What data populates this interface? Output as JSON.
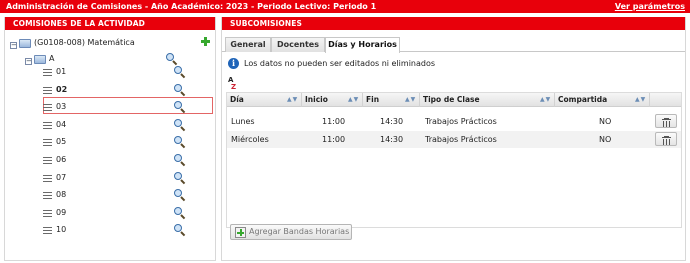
{
  "topbar": {
    "title": "Administración de Comisiones - Año Académico: 2023 - Periodo Lectivo: Periodo 1",
    "params_link": "Ver parámetros"
  },
  "left_panel": {
    "title": "COMISIONES DE LA ACTIVIDAD",
    "root": {
      "label": "(G0108-008) Matemática",
      "expanded": true
    },
    "group": {
      "label": "A",
      "expanded": true
    },
    "items": [
      {
        "label": "01"
      },
      {
        "label": "02",
        "selected": true
      },
      {
        "label": "03"
      },
      {
        "label": "04"
      },
      {
        "label": "05"
      },
      {
        "label": "06"
      },
      {
        "label": "07"
      },
      {
        "label": "08"
      },
      {
        "label": "09"
      },
      {
        "label": "10"
      }
    ]
  },
  "right_panel": {
    "title": "SUBCOMISIONES",
    "tabs": [
      {
        "label": "General",
        "active": false
      },
      {
        "label": "Docentes",
        "active": false
      },
      {
        "label": "Días y Horarios",
        "active": true
      }
    ],
    "info_text": "Los datos no pueden ser editados ni eliminados",
    "sort_icon_text": {
      "a": "A",
      "z": "Z"
    },
    "table": {
      "columns": [
        "Día",
        "Inicio",
        "Fin",
        "Tipo de Clase",
        "Compartida"
      ],
      "rows": [
        {
          "dia": "Lunes",
          "inicio": "11:00",
          "fin": "14:30",
          "tipo": "Trabajos Prácticos",
          "compartida": "NO"
        },
        {
          "dia": "Miércoles",
          "inicio": "11:00",
          "fin": "14:30",
          "tipo": "Trabajos Prácticos",
          "compartida": "NO"
        }
      ]
    },
    "add_button": "Agregar Bandas Horarias"
  },
  "colors": {
    "header_red": "#e8000b",
    "selection_border": "#e36565",
    "info_blue": "#1f64b8",
    "add_green": "#36a82e"
  }
}
